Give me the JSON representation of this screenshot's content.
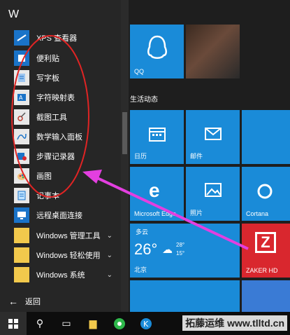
{
  "start_menu": {
    "section_letter": "W",
    "apps": [
      {
        "label": "XPS 查看器",
        "icon": "xps-viewer-icon"
      },
      {
        "label": "便利贴",
        "icon": "sticky-notes-icon"
      },
      {
        "label": "写字板",
        "icon": "wordpad-icon"
      },
      {
        "label": "字符映射表",
        "icon": "character-map-icon"
      },
      {
        "label": "截图工具",
        "icon": "snipping-tool-icon"
      },
      {
        "label": "数学输入面板",
        "icon": "math-input-panel-icon"
      },
      {
        "label": "步骤记录器",
        "icon": "steps-recorder-icon"
      },
      {
        "label": "画图",
        "icon": "paint-icon"
      },
      {
        "label": "记事本",
        "icon": "notepad-icon"
      },
      {
        "label": "远程桌面连接",
        "icon": "remote-desktop-icon"
      }
    ],
    "folders": [
      {
        "label": "Windows 管理工具"
      },
      {
        "label": "Windows 轻松使用"
      },
      {
        "label": "Windows 系统"
      }
    ],
    "back_label": "返回"
  },
  "tiles": {
    "qq_label": "QQ",
    "section_title": "生活动态",
    "calendar_label": "日历",
    "mail_label": "邮件",
    "edge_label": "Microsoft Edge",
    "photos_label": "照片",
    "cortana_label": "Cortana",
    "weather": {
      "condition": "多云",
      "temp": "26°",
      "high": "28°",
      "low": "15°",
      "city": "北京"
    },
    "zaker_label": "ZAKER HD"
  },
  "watermark": {
    "text": "拓藤运维 www.tlltd.cn"
  },
  "colors": {
    "tile_blue": "#1a8bd8",
    "accent_pink": "#e33fe0",
    "annotation_red": "#e02424",
    "zaker_red": "#d9272e"
  }
}
